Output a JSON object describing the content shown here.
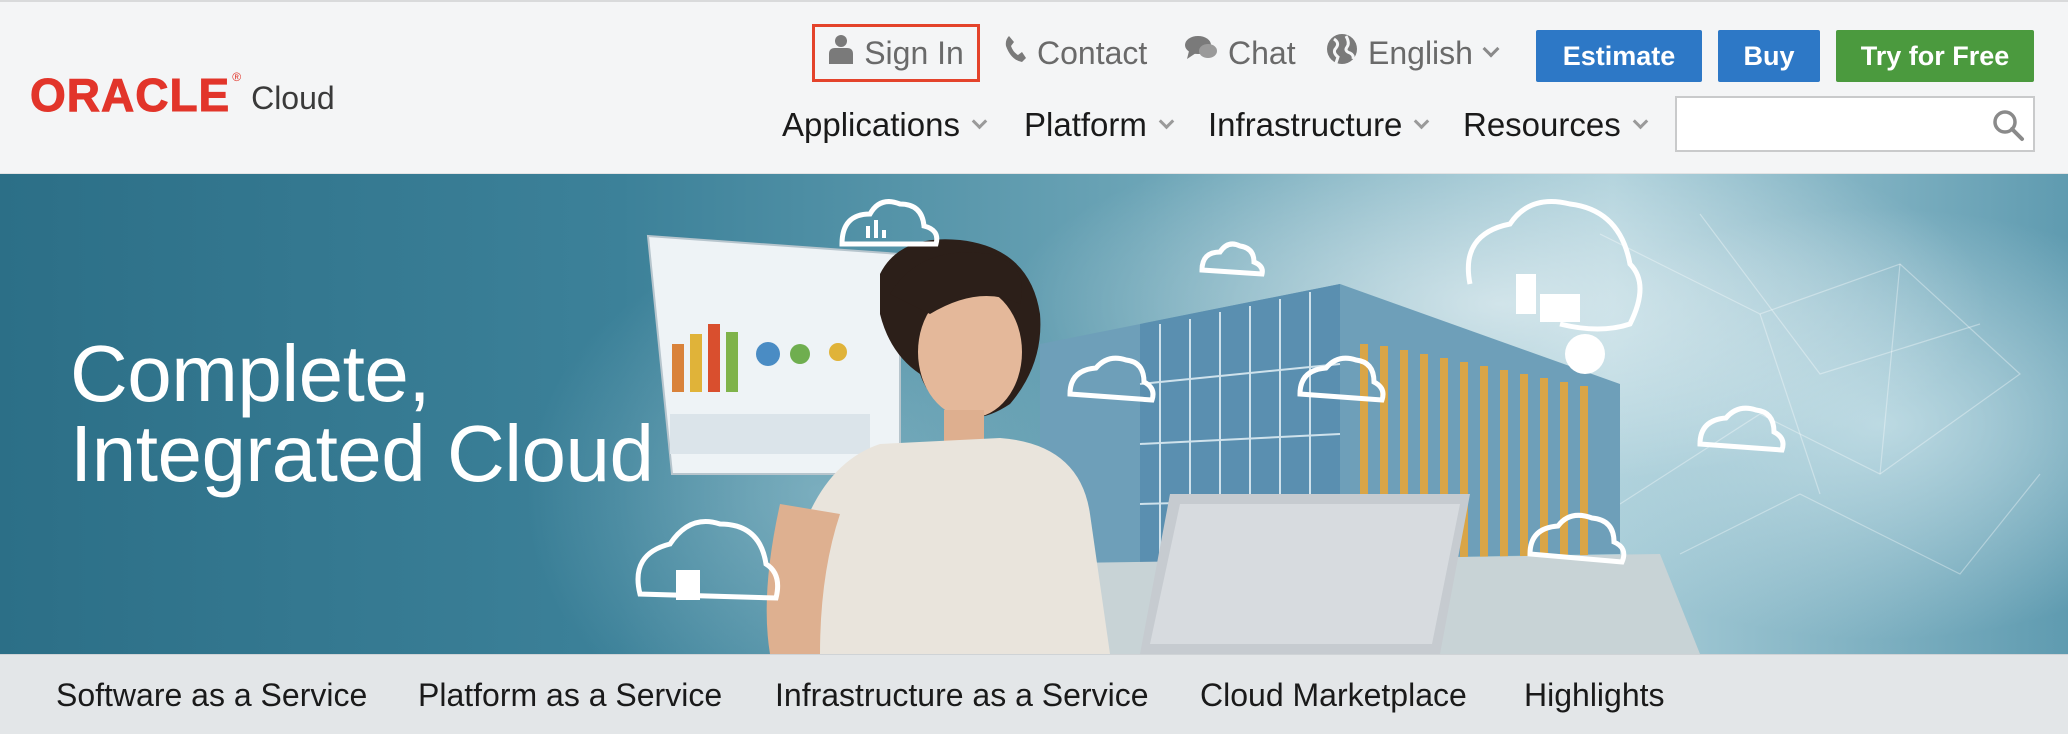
{
  "brand": {
    "name": "ORACLE",
    "product": "Cloud",
    "color": "#e2352a"
  },
  "utility_nav": {
    "sign_in": "Sign In",
    "contact": "Contact",
    "chat": "Chat",
    "language": "English"
  },
  "buttons": {
    "estimate": "Estimate",
    "buy": "Buy",
    "try_free": "Try for Free",
    "blue": "#2d78c6",
    "green": "#4b9a3e"
  },
  "main_nav": [
    {
      "label": "Applications"
    },
    {
      "label": "Platform"
    },
    {
      "label": "Infrastructure"
    },
    {
      "label": "Resources"
    }
  ],
  "search": {
    "placeholder": "",
    "value": ""
  },
  "hero": {
    "headline_line1": "Complete,",
    "headline_line2": "Integrated Cloud"
  },
  "tabs": [
    {
      "label": "Software as a Service"
    },
    {
      "label": "Platform as a Service"
    },
    {
      "label": "Infrastructure as a Service"
    },
    {
      "label": "Cloud Marketplace"
    },
    {
      "label": "Highlights"
    }
  ]
}
